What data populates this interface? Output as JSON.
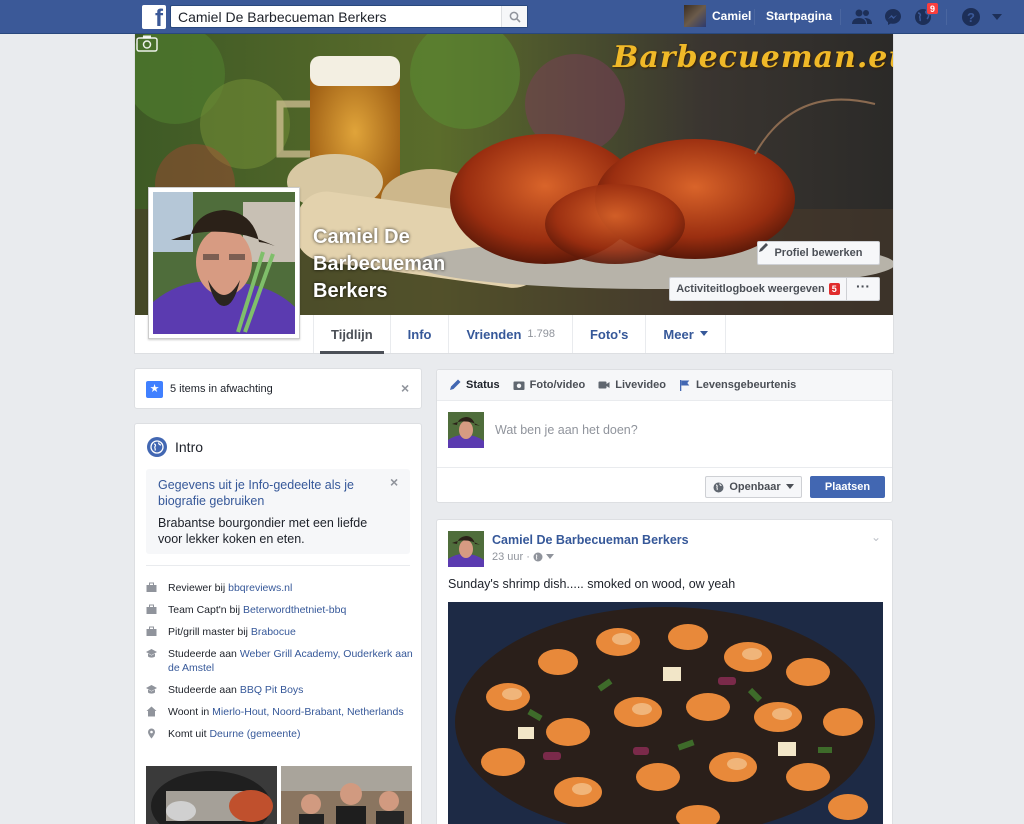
{
  "topbar": {
    "logo": "f",
    "search_value": "Camiel De Barbecueman Berkers",
    "user_name": "Camiel",
    "home_label": "Startpagina",
    "notification_count": "9",
    "icons": [
      "friends-icon",
      "messenger-icon",
      "globe-icon",
      "help-icon",
      "caret-down-icon"
    ]
  },
  "cover": {
    "brand_text": "Barbecueman.eu",
    "profile_name": "Camiel De Barbecueman Berkers",
    "edit_profile_label": "Profiel bewerken",
    "activity_log_label": "Activiteitlogboek weergeven",
    "activity_log_count": "5",
    "more_label": "···"
  },
  "tabs": [
    {
      "label": "Tijdlijn",
      "count": ""
    },
    {
      "label": "Info",
      "count": ""
    },
    {
      "label": "Vrienden",
      "count": "1.798"
    },
    {
      "label": "Foto's",
      "count": ""
    },
    {
      "label": "Meer",
      "count": ""
    }
  ],
  "pending": {
    "text": "5 items in afwachting"
  },
  "intro": {
    "title": "Intro",
    "bio_prompt": "Gegevens uit je Info-gedeelte als je biografie gebruiken",
    "bio_text": "Brabantse bourgondier met een liefde voor lekker koken en eten.",
    "items": [
      {
        "icon": "briefcase-icon",
        "prefix": "Reviewer bij ",
        "link": "bbqreviews.nl"
      },
      {
        "icon": "briefcase-icon",
        "prefix": "Team Capt'n bij ",
        "link": "Beterwordthetniet-bbq"
      },
      {
        "icon": "briefcase-icon",
        "prefix": "Pit/grill master bij ",
        "link": "Brabocue"
      },
      {
        "icon": "graduation-cap-icon",
        "prefix": "Studeerde aan ",
        "link": "Weber Grill Academy, Ouderkerk aan de Amstel"
      },
      {
        "icon": "graduation-cap-icon",
        "prefix": "Studeerde aan ",
        "link": "BBQ Pit Boys"
      },
      {
        "icon": "house-icon",
        "prefix": "Woont in ",
        "link": "Mierlo-Hout, Noord-Brabant, Netherlands"
      },
      {
        "icon": "location-pin-icon",
        "prefix": "Komt uit ",
        "link": "Deurne (gemeente)"
      }
    ]
  },
  "composer": {
    "tabs": [
      "Status",
      "Foto/video",
      "Livevideo",
      "Levensgebeurtenis"
    ],
    "placeholder": "Wat ben je aan het doen?",
    "audience_label": "Openbaar",
    "post_label": "Plaatsen"
  },
  "post": {
    "author": "Camiel De Barbecueman Berkers",
    "time": "23 uur",
    "text": "Sunday's shrimp dish..... smoked on wood, ow yeah"
  },
  "colors": {
    "brand_blue": "#3b5998",
    "link_blue": "#365899",
    "button_blue": "#4267b2",
    "badge_red": "#fa3e3e",
    "background": "#e9ebee"
  }
}
